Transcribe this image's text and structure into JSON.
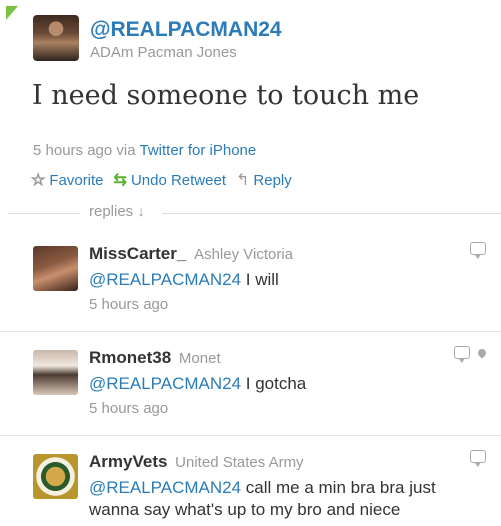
{
  "tweet": {
    "handle": "@REALPACMAN24",
    "name": "ADAm Pacman Jones",
    "text": "I need someone to touch me",
    "time": "5 hours ago",
    "via": "via",
    "client": "Twitter for iPhone",
    "actions": {
      "favorite": "Favorite",
      "retweet": "Undo Retweet",
      "reply": "Reply"
    },
    "accent_color": "#2b7bb9",
    "retweet_color": "#5cb135"
  },
  "replies_label": "replies ↓",
  "replies": [
    {
      "username": "MissCarter_",
      "name": "Ashley Victoria",
      "mention": "@REALPACMAN24",
      "text": " I will",
      "time": "5 hours ago",
      "icons": [
        "reply-bubble-icon"
      ]
    },
    {
      "username": "Rmonet38",
      "name": "Monet",
      "mention": "@REALPACMAN24",
      "text": " I gotcha",
      "time": "5 hours ago",
      "icons": [
        "reply-bubble-icon",
        "location-pin-icon"
      ]
    },
    {
      "username": "ArmyVets",
      "name": "United States Army",
      "mention": "@REALPACMAN24",
      "text": " call me a min bra bra just wanna say what's up to my bro and niece",
      "time": "",
      "icons": [
        "reply-bubble-icon"
      ]
    }
  ]
}
